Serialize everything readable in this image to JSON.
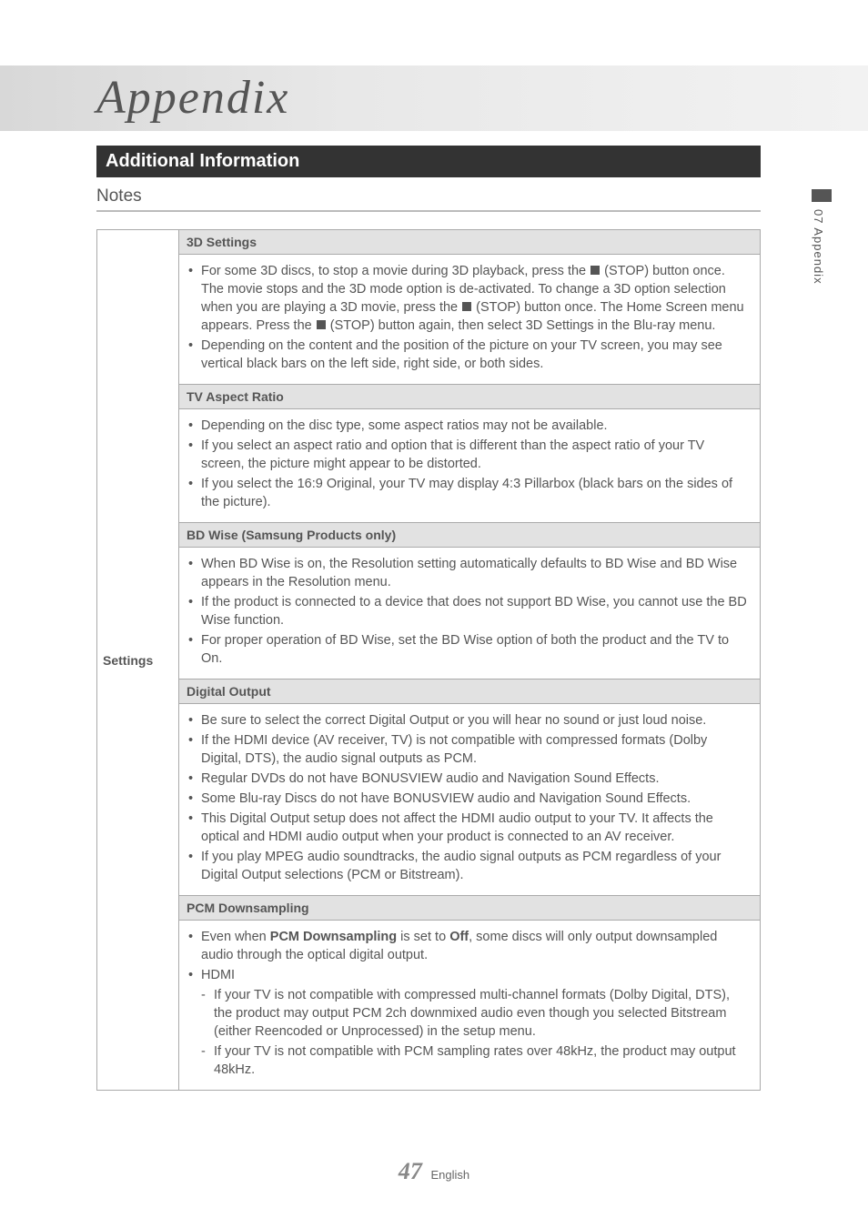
{
  "page": {
    "title": "Appendix",
    "section_bar": "Additional Information",
    "notes_heading": "Notes",
    "side_tab": "07  Appendix",
    "page_number": "47",
    "page_lang": "English"
  },
  "table": {
    "left_label": "Settings",
    "rows": [
      {
        "type": "subhead",
        "text": "3D Settings"
      },
      {
        "type": "body",
        "items": [
          {
            "kind": "bullet",
            "html": "For some 3D discs, to stop a movie during 3D playback, press the [STOP] (STOP) button once. The movie stops and the 3D mode option is de-activated. To change a 3D option selection when you are playing a 3D movie, press the [STOP] (STOP) button once. The Home Screen menu appears. Press the [STOP] (STOP) button again, then select 3D Settings in the Blu-ray menu."
          },
          {
            "kind": "bullet",
            "html": "Depending on the content and the position of the picture on your TV screen, you may see vertical black bars on the left side, right side, or both sides."
          }
        ]
      },
      {
        "type": "subhead",
        "text": "TV Aspect Ratio"
      },
      {
        "type": "body",
        "items": [
          {
            "kind": "bullet",
            "html": "Depending on the disc type, some aspect ratios may not be available."
          },
          {
            "kind": "bullet",
            "html": "If you select an aspect ratio and option that is different than the aspect ratio of your TV screen, the picture might appear to be distorted."
          },
          {
            "kind": "bullet",
            "html": "If you select the 16:9 Original, your TV may display 4:3 Pillarbox (black bars on the sides of the picture)."
          }
        ]
      },
      {
        "type": "subhead",
        "text": "BD Wise (Samsung Products only)"
      },
      {
        "type": "body",
        "items": [
          {
            "kind": "bullet",
            "html": "When BD Wise is on, the Resolution setting automatically defaults to BD Wise and BD Wise appears in the Resolution menu."
          },
          {
            "kind": "bullet",
            "html": "If the product is connected to a device that does not support BD Wise, you cannot use the BD Wise function."
          },
          {
            "kind": "bullet",
            "html": "For proper operation of BD Wise, set the BD Wise option of both the product and the TV to On."
          }
        ]
      },
      {
        "type": "subhead",
        "text": "Digital Output"
      },
      {
        "type": "body",
        "items": [
          {
            "kind": "bullet",
            "html": "Be sure to select the correct Digital Output or you will hear no sound or just loud noise."
          },
          {
            "kind": "bullet",
            "html": "If the HDMI device (AV receiver, TV) is not compatible with compressed formats (Dolby Digital, DTS), the audio signal outputs as PCM."
          },
          {
            "kind": "bullet",
            "html": "Regular DVDs do not have BONUSVIEW audio and Navigation Sound Effects."
          },
          {
            "kind": "bullet",
            "html": "Some Blu-ray Discs do not have BONUSVIEW audio and Navigation Sound Effects."
          },
          {
            "kind": "bullet",
            "html": "This Digital Output setup does not affect the HDMI audio output to your TV. It affects the optical and HDMI audio output when your product is connected to an AV receiver."
          },
          {
            "kind": "bullet",
            "html": "If you play MPEG audio soundtracks, the audio signal outputs as PCM regardless of your Digital Output selections (PCM or Bitstream)."
          }
        ]
      },
      {
        "type": "subhead",
        "text": "PCM Downsampling"
      },
      {
        "type": "body",
        "items": [
          {
            "kind": "bullet",
            "html": "Even when <b>PCM Downsampling</b> is set to <b>Off</b>, some discs will only output downsampled audio through the optical digital output."
          },
          {
            "kind": "bullet",
            "html": "HDMI"
          },
          {
            "kind": "dash",
            "html": "If your TV is not compatible with compressed multi-channel formats (Dolby Digital, DTS), the product may output PCM 2ch downmixed audio even though you selected Bitstream (either Reencoded or Unprocessed) in the setup menu."
          },
          {
            "kind": "dash",
            "html": "If your TV is not compatible with PCM sampling rates over 48kHz, the product may output 48kHz."
          }
        ]
      }
    ]
  }
}
